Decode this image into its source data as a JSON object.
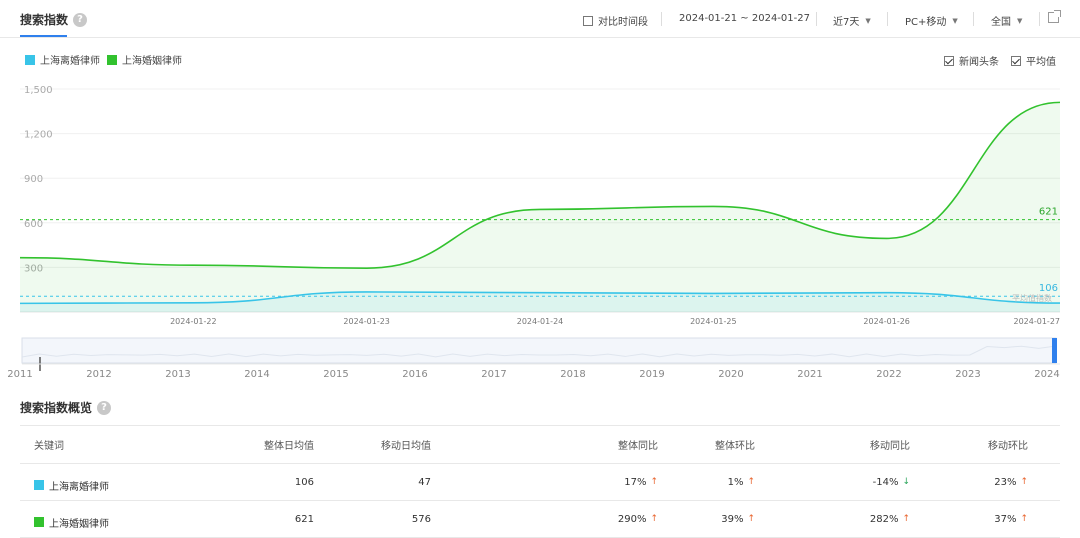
{
  "header": {
    "title": "搜索指数",
    "compare_label": "对比时间段",
    "date_range": "2024-01-21 ~ 2024-01-27",
    "period": "近7天",
    "device": "PC+移动",
    "region": "全国"
  },
  "legend": [
    {
      "name": "上海离婚律师",
      "color": "#38c4e8"
    },
    {
      "name": "上海婚姻律师",
      "color": "#32c22e"
    }
  ],
  "options": {
    "news_label": "新闻头条",
    "avg_label": "平均值"
  },
  "chart_data": {
    "type": "area",
    "x": [
      "2024-01-21",
      "2024-01-22",
      "2024-01-23",
      "2024-01-24",
      "2024-01-25",
      "2024-01-26",
      "2024-01-27"
    ],
    "ylim": [
      0,
      1500
    ],
    "yticks": [
      "1,500",
      "1,200",
      "900",
      "600",
      "300"
    ],
    "xticklabels": [
      "2024-01-22",
      "2024-01-23",
      "2024-01-24",
      "2024-01-25",
      "2024-01-26",
      "2024-01-27"
    ],
    "series": [
      {
        "name": "上海离婚律师",
        "color": "#38c4e8",
        "values": [
          58,
          62,
          135,
          130,
          125,
          130,
          60
        ],
        "average": 106,
        "average_label": "106"
      },
      {
        "name": "上海婚姻律师",
        "color": "#32c22e",
        "values": [
          365,
          315,
          295,
          690,
          710,
          495,
          1410
        ],
        "average": 621,
        "average_label": "621"
      }
    ],
    "avg_note": "平均值指数",
    "grid": true
  },
  "slider": {
    "years": [
      "2011",
      "2012",
      "2013",
      "2014",
      "2015",
      "2016",
      "2017",
      "2018",
      "2019",
      "2020",
      "2021",
      "2022",
      "2023",
      "2024"
    ]
  },
  "overview": {
    "title": "搜索指数概览",
    "columns": [
      "关键词",
      "整体日均值",
      "移动日均值",
      "整体同比",
      "整体环比",
      "移动同比",
      "移动环比"
    ],
    "rows": [
      {
        "keyword": "上海离婚律师",
        "color": "#38c4e8",
        "overall_avg": "106",
        "mobile_avg": "47",
        "overall_yoy": "17%",
        "overall_yoy_dir": "up",
        "overall_mom": "1%",
        "overall_mom_dir": "up",
        "mobile_yoy": "-14%",
        "mobile_yoy_dir": "down",
        "mobile_mom": "23%",
        "mobile_mom_dir": "up"
      },
      {
        "keyword": "上海婚姻律师",
        "color": "#32c22e",
        "overall_avg": "621",
        "mobile_avg": "576",
        "overall_yoy": "290%",
        "overall_yoy_dir": "up",
        "overall_mom": "39%",
        "overall_mom_dir": "up",
        "mobile_yoy": "282%",
        "mobile_yoy_dir": "up",
        "mobile_mom": "37%",
        "mobile_mom_dir": "up"
      }
    ]
  }
}
